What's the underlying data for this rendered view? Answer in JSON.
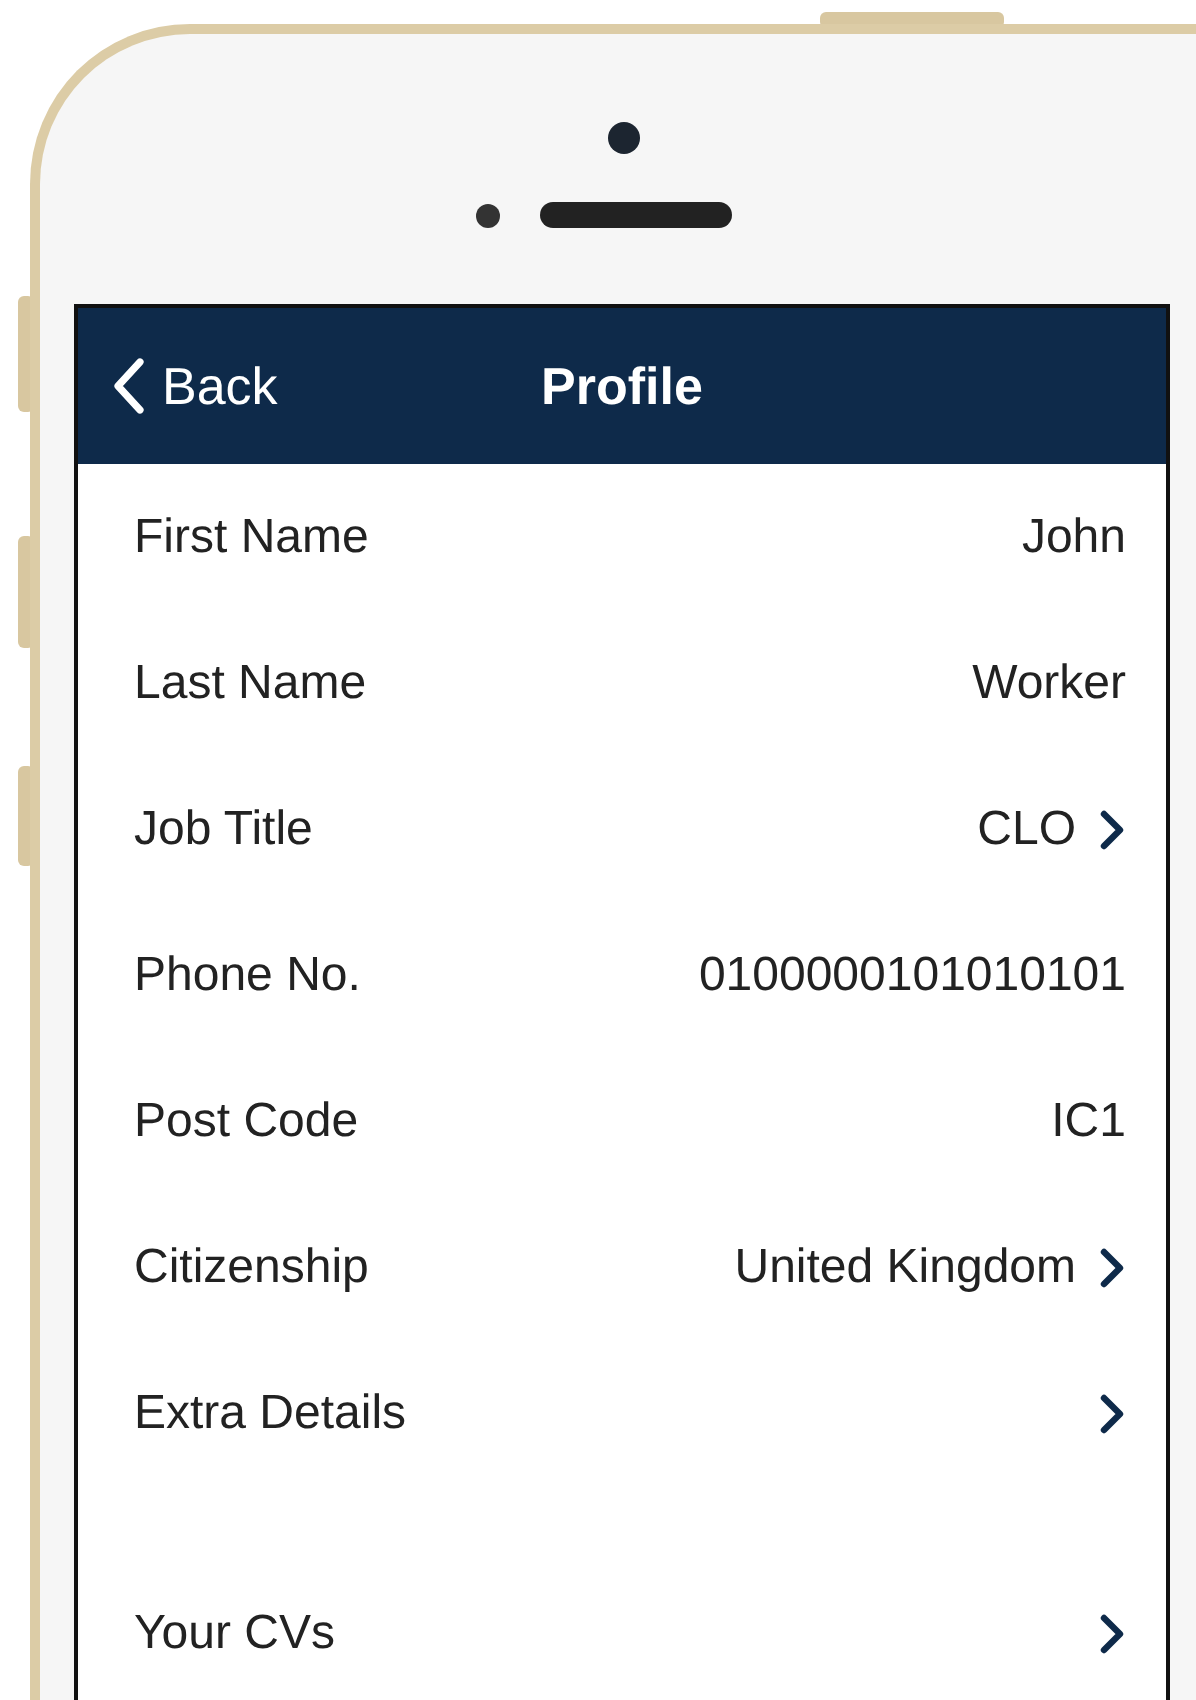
{
  "nav_bar": {
    "back_label": "Back",
    "title": "Profile"
  },
  "sections": [
    {
      "rows": [
        {
          "label": "First Name",
          "value": "John",
          "disclosure": false
        },
        {
          "label": "Last Name",
          "value": "Worker",
          "disclosure": false
        },
        {
          "label": "Job Title",
          "value": "CLO",
          "disclosure": true
        },
        {
          "label": "Phone No.",
          "value": "0100000101010101",
          "disclosure": false
        },
        {
          "label": "Post Code",
          "value": "IC1",
          "disclosure": false
        },
        {
          "label": "Citizenship",
          "value": "United Kingdom",
          "disclosure": true
        },
        {
          "label": "Extra Details",
          "disclosure": true
        }
      ]
    },
    {
      "rows": [
        {
          "label": "Your CVs",
          "disclosure": true
        }
      ]
    }
  ]
}
